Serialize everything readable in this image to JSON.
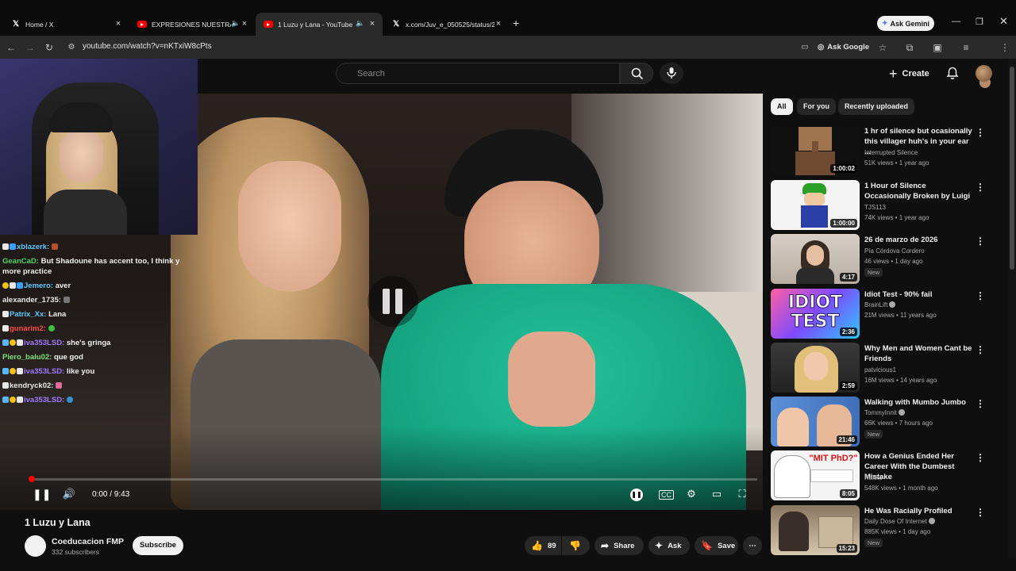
{
  "browser": {
    "tabs": [
      {
        "label": "Home / X"
      },
      {
        "label": "EXPRESIONES NUESTRAS -"
      },
      {
        "label": "1 Luzu y Lana - YouTube"
      },
      {
        "label": "x.com/Juv_e_050525/status/20"
      }
    ],
    "ask_gemini": "Ask Gemini",
    "url": "youtube.com/watch?v=nKTxiW8cPts",
    "ask_google": "Ask Google"
  },
  "header": {
    "search_placeholder": "Search",
    "create_label": "Create"
  },
  "player": {
    "time": "0:00 / 9:43",
    "progress": 0.0
  },
  "chat": [
    {
      "user": "xblazerk:",
      "msg": "",
      "color": "#5ec8ff"
    },
    {
      "user": "GeanCaD:",
      "msg": "But Shadoune has accent too, I think y",
      "color": "#4fd46b"
    },
    {
      "user": "",
      "msg": "more practice",
      "color": "#ffffff"
    },
    {
      "user": "Jemero:",
      "msg": "aver",
      "color": "#5ec8ff"
    },
    {
      "user": "alexander_1735:",
      "msg": "",
      "color": "#e8e8e8"
    },
    {
      "user": "Patrix_Xx:",
      "msg": "Lana",
      "color": "#5ec8ff"
    },
    {
      "user": "gunarim2:",
      "msg": "",
      "color": "#ff4a4a"
    },
    {
      "user": "iva353LSD:",
      "msg": "she's gringa",
      "color": "#a07bff"
    },
    {
      "user": "Piero_balu02:",
      "msg": "que god",
      "color": "#7ee07a"
    },
    {
      "user": "iva353LSD:",
      "msg": "like you",
      "color": "#a07bff"
    },
    {
      "user": "kendryck02:",
      "msg": "",
      "color": "#e8e8e8"
    },
    {
      "user": "iva353LSD:",
      "msg": "",
      "color": "#a07bff"
    }
  ],
  "video": {
    "title": "1 Luzu y Lana",
    "channel": "Coeducacion FMP",
    "subscribers": "332 subscribers",
    "subscribe_label": "Subscribe",
    "likes": "89",
    "share_label": "Share",
    "ask_label": "Ask",
    "save_label": "Save"
  },
  "filters": [
    {
      "label": "All"
    },
    {
      "label": "For you"
    },
    {
      "label": "Recently uploaded"
    }
  ],
  "recommendations": [
    {
      "title": "1 hr of silence but ocasionally this villager huh's in your ear ...",
      "channel": "Interrupted Silence",
      "meta": "51K views • 1 year ago",
      "duration": "1:00:02",
      "verified": false,
      "new": ""
    },
    {
      "title": "1 Hour of Silence Occasionally Broken by Luigi",
      "channel": "TJS113",
      "meta": "74K views • 1 year ago",
      "duration": "1:00:00",
      "verified": false,
      "new": ""
    },
    {
      "title": "26 de marzo de 2026",
      "channel": "Pía Córdova Cordero",
      "meta": "46 views • 1 day ago",
      "duration": "4:17",
      "verified": false,
      "new": "New"
    },
    {
      "title": "Idiot Test - 90% fail",
      "channel": "BrainLift",
      "meta": "21M views • 11 years ago",
      "duration": "2:36",
      "verified": true,
      "new": ""
    },
    {
      "title": "Why Men and Women Cant be Friends",
      "channel": "patvicious1",
      "meta": "16M views • 14 years ago",
      "duration": "2:59",
      "verified": false,
      "new": ""
    },
    {
      "title": "Walking with Mumbo Jumbo",
      "channel": "TommyInnit",
      "meta": "66K views • 7 hours ago",
      "duration": "21:46",
      "verified": true,
      "new": "New"
    },
    {
      "title": "How a Genius Ended Her Career With the Dumbest Mistake",
      "channel": "Rakko",
      "meta": "548K views • 1 month ago",
      "duration": "8:05",
      "verified": false,
      "new": ""
    },
    {
      "title": "He Was Racially Profiled",
      "channel": "Daily Dose Of Internet",
      "meta": "885K views • 1 day ago",
      "duration": "15:23",
      "verified": true,
      "new": "New"
    }
  ],
  "thumb_labels": {
    "idiot_test": "IDIOT TEST",
    "mit_phd": "\"MIT PhD?\""
  }
}
